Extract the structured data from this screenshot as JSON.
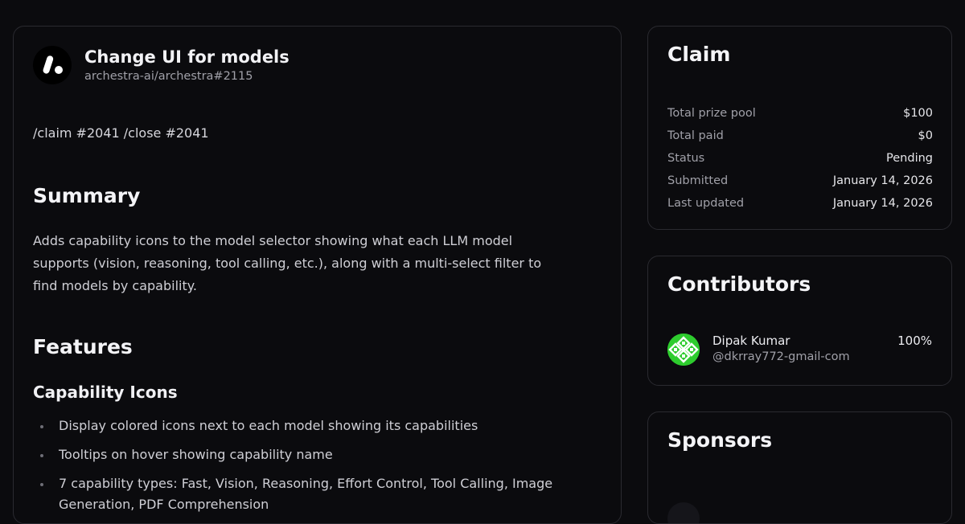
{
  "issue": {
    "title": "Change UI for models",
    "repo": "archestra-ai/archestra#2115",
    "command": "/claim #2041 /close #2041",
    "logo_icon": "archestra-logo-icon"
  },
  "summary": {
    "heading": "Summary",
    "body": "Adds capability icons to the model selector showing what each LLM model supports (vision, reasoning, tool calling, etc.), along with a multi-select filter to find models by capability."
  },
  "features": {
    "heading": "Features",
    "subheading": "Capability Icons",
    "items": [
      "Display colored icons next to each model showing its capabilities",
      "Tooltips on hover showing capability name",
      "7 capability types: Fast, Vision, Reasoning, Effort Control, Tool Calling, Image Generation, PDF Comprehension"
    ]
  },
  "claim": {
    "heading": "Claim",
    "rows": [
      {
        "label": "Total prize pool",
        "value": "$100"
      },
      {
        "label": "Total paid",
        "value": "$0"
      },
      {
        "label": "Status",
        "value": "Pending"
      },
      {
        "label": "Submitted",
        "value": "January 14, 2026"
      },
      {
        "label": "Last updated",
        "value": "January 14, 2026"
      }
    ]
  },
  "contributors": {
    "heading": "Contributors",
    "items": [
      {
        "name": "Dipak Kumar",
        "handle": "@dkrray772-gmail-com",
        "share": "100%",
        "avatar_color": "#2ecc2e"
      }
    ]
  },
  "sponsors": {
    "heading": "Sponsors"
  },
  "colors": {
    "background": "#0b0b0e",
    "border": "#2a2a30",
    "muted_text": "#a0a0a8"
  }
}
